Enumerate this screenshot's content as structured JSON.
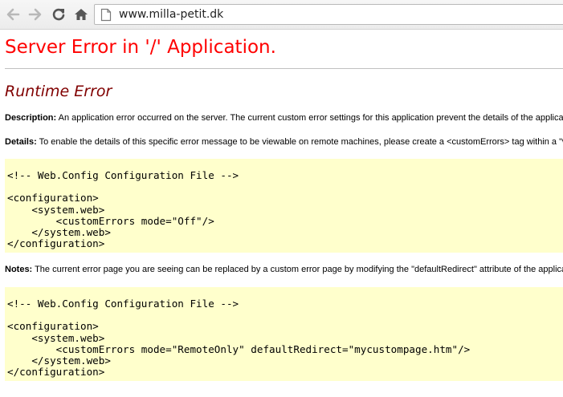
{
  "browser": {
    "url": "www.milla-petit.dk",
    "icons": [
      "back-arrow-icon",
      "forward-arrow-icon",
      "reload-icon",
      "home-icon",
      "page-icon"
    ]
  },
  "page": {
    "title": "Server Error in '/' Application.",
    "heading": "Runtime Error",
    "description_label": "Description:",
    "description_text": " An application error occurred on the server. The current custom error settings for this application prevent the details of the application error from being viewed remotely (for security reasons).",
    "details_label": "Details:",
    "details_text": " To enable the details of this specific error message to be viewable on remote machines, please create a <customErrors> tag within a \"web.config\" configuration file located in the root directory of the current web application.",
    "code_block_1": "<!-- Web.Config Configuration File -->\n\n<configuration>\n    <system.web>\n        <customErrors mode=\"Off\"/>\n    </system.web>\n</configuration>",
    "notes_label": "Notes:",
    "notes_text": " The current error page you are seeing can be replaced by a custom error page by modifying the \"defaultRedirect\" attribute of the application's <customErrors> configuration tag to point to a custom error page URL.",
    "code_block_2": "<!-- Web.Config Configuration File -->\n\n<configuration>\n    <system.web>\n        <customErrors mode=\"RemoteOnly\" defaultRedirect=\"mycustompage.htm\"/>\n    </system.web>\n</configuration>"
  },
  "colors": {
    "title": "#ff0000",
    "heading": "#800000",
    "code_background": "#ffffcc"
  }
}
